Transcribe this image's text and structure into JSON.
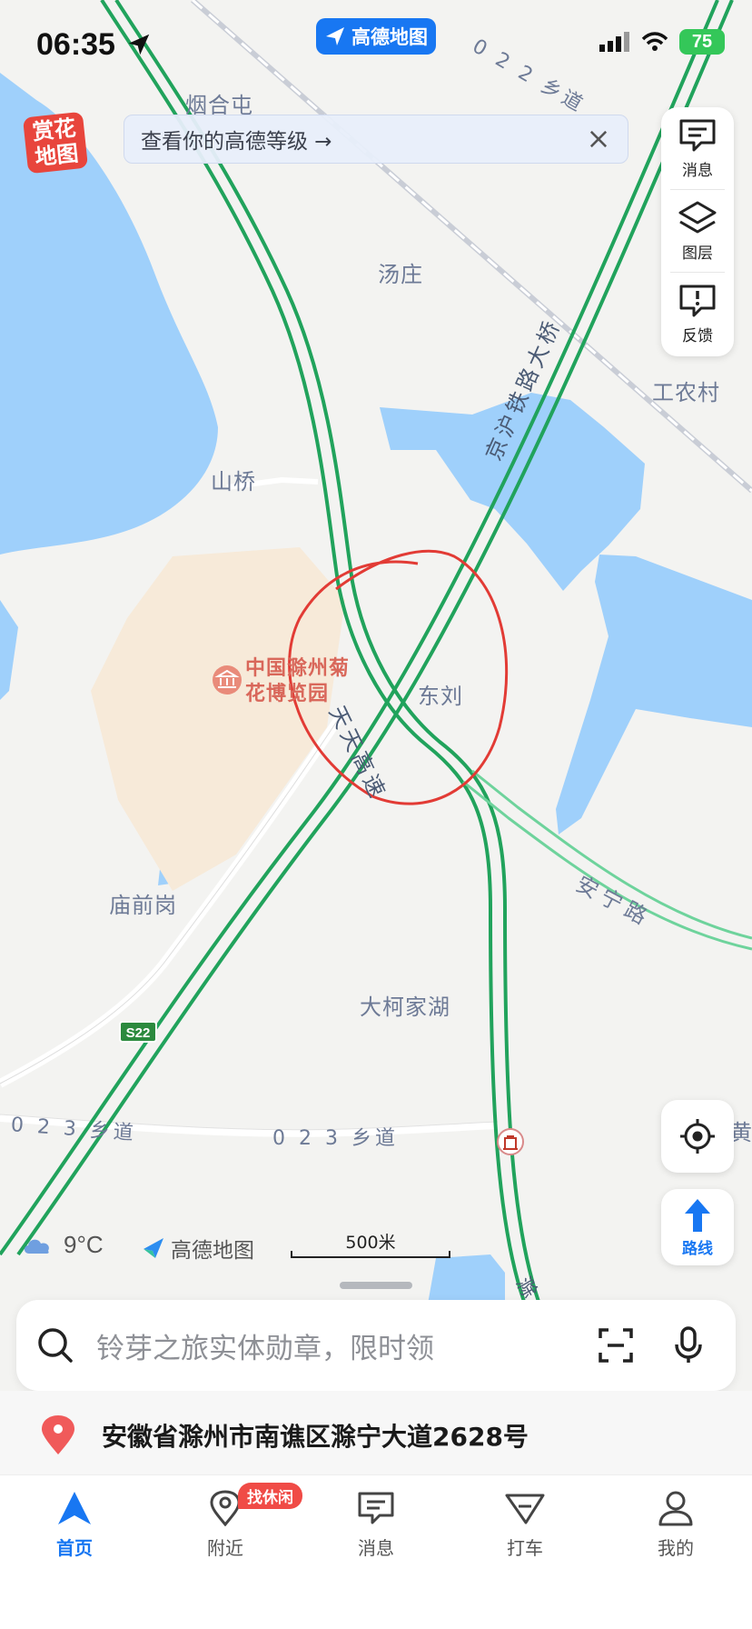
{
  "status_bar": {
    "time": "06:35",
    "battery": "75"
  },
  "brand_pill": {
    "label": "高德地图"
  },
  "flower_logo": {
    "line1": "赏花",
    "line2": "地图"
  },
  "banner": {
    "text": "查看你的高德等级 →"
  },
  "side_panel": [
    {
      "label": "消息",
      "icon": "message-icon"
    },
    {
      "label": "图层",
      "icon": "layers-icon"
    },
    {
      "label": "反馈",
      "icon": "feedback-icon"
    }
  ],
  "map": {
    "labels": {
      "yanhetun": "烟合屯",
      "tangzhuang": "汤庄",
      "gongnongcun": "工农村",
      "shanqiao": "山桥",
      "dongliu": "东刘",
      "miaoqiangang": "庙前岗",
      "dakejiahu": "大柯家湖",
      "poi": "中国滁州菊花博览园",
      "rail_bridge": "京沪铁路大桥",
      "expressway": "天天高速",
      "anning_road": "安宁路",
      "village_road": "0 2 3 乡道",
      "village_road_top": "0 2 2 乡道",
      "route_shield": "S22",
      "edge_right": "黄",
      "chu_partial": "滁"
    },
    "colors": {
      "water": "#9fd0fb",
      "land": "#f3f3f1",
      "highway": "#21a35c",
      "poi_area": "#f7ead9",
      "annotation": "#e23b35"
    }
  },
  "locate_button": {
    "icon": "target-icon"
  },
  "route_button": {
    "label": "路线"
  },
  "weather": {
    "temp": "9°C",
    "icon": "cloud-icon"
  },
  "map_brand": {
    "label": "高德地图"
  },
  "scale": {
    "label": "500米"
  },
  "search": {
    "placeholder": "铃芽之旅实体勋章，限时领"
  },
  "address": {
    "text": "安徽省滁州市南谯区滁宁大道2628号"
  },
  "tabs": [
    {
      "label": "首页",
      "active": true
    },
    {
      "label": "附近",
      "badge": "找休闲"
    },
    {
      "label": "消息"
    },
    {
      "label": "打车"
    },
    {
      "label": "我的"
    }
  ]
}
